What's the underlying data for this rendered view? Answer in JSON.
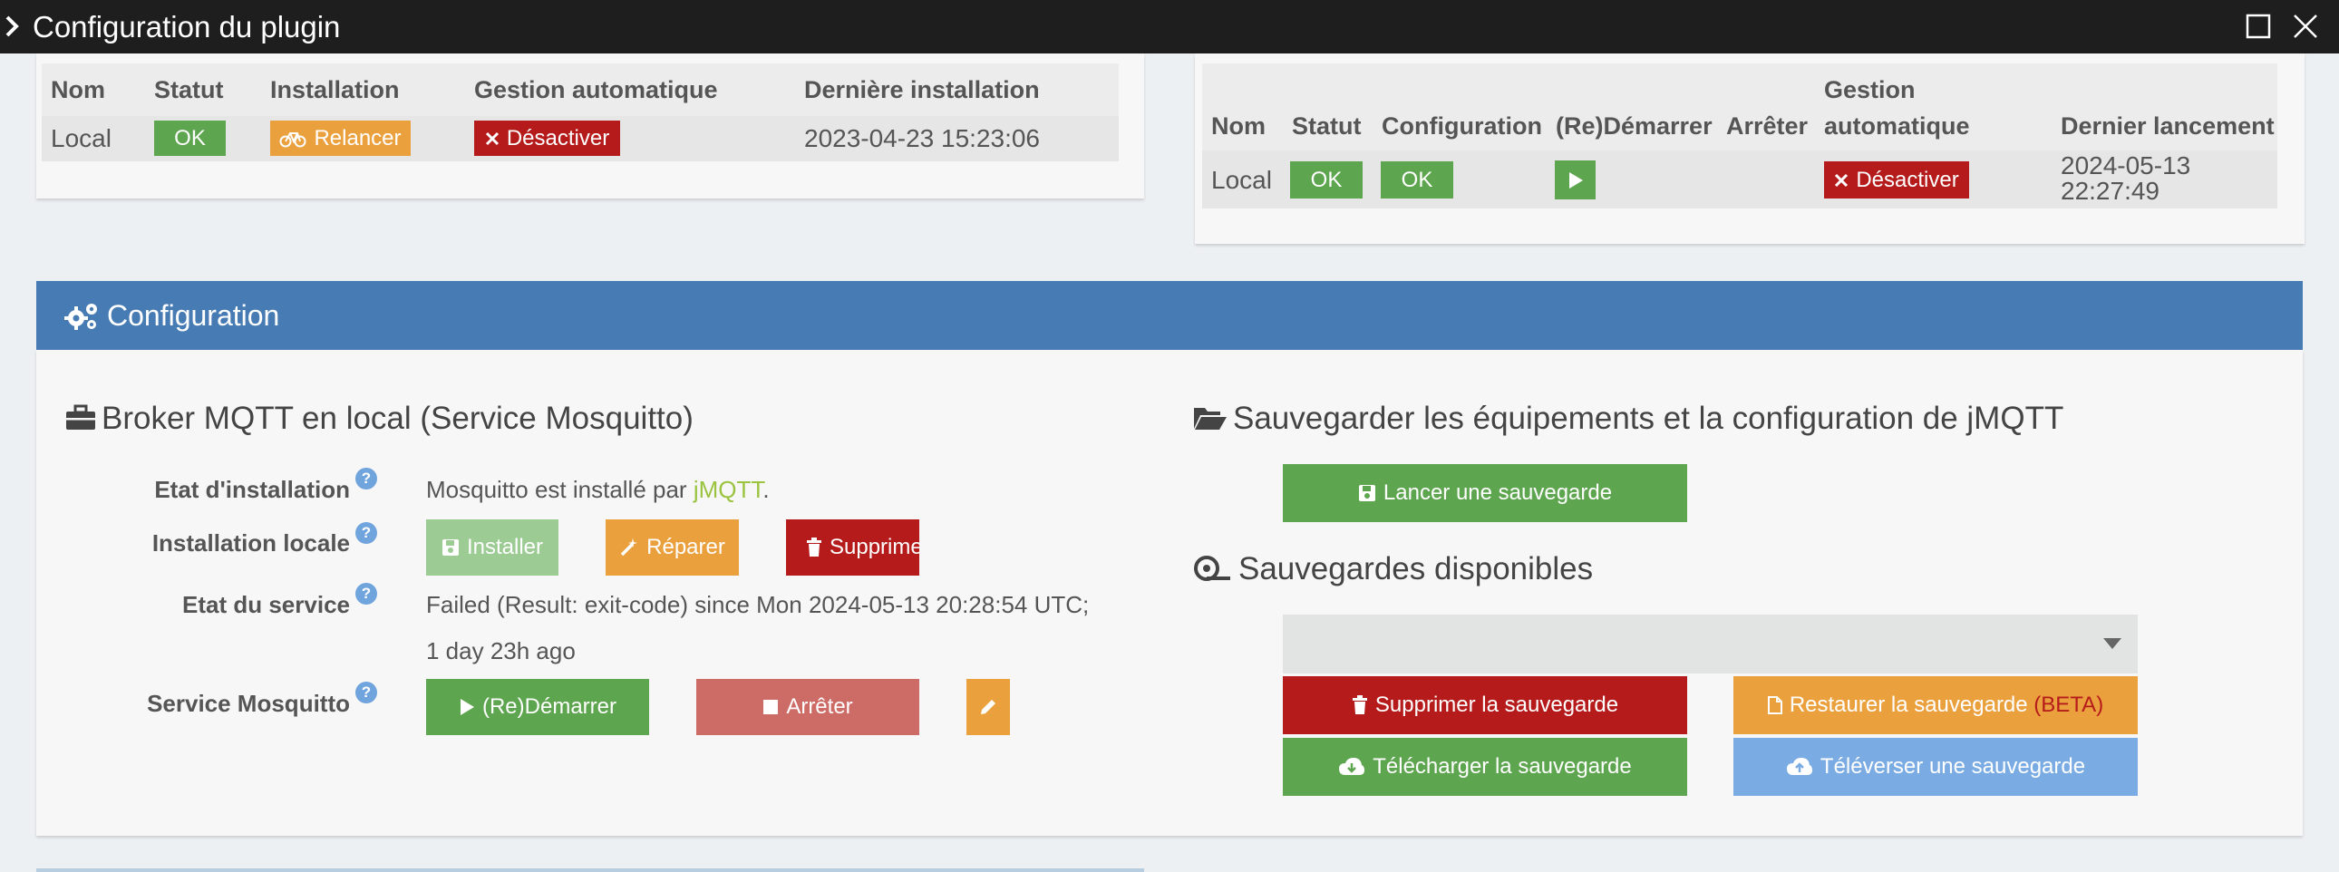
{
  "window": {
    "title": "Configuration du plugin"
  },
  "dependencies": {
    "headers": [
      "Nom",
      "Statut",
      "Installation",
      "Gestion automatique",
      "Dernière installation"
    ],
    "row": {
      "name": "Local",
      "status": "OK",
      "install_button": "Relancer",
      "auto_button": "Désactiver",
      "last_install": "2023-04-23 15:23:06"
    }
  },
  "daemon": {
    "headers": [
      "Nom",
      "Statut",
      "Configuration",
      "(Re)Démarrer",
      "Arrêter",
      "Gestion",
      "automatique",
      "Dernier lancement"
    ],
    "row": {
      "name": "Local",
      "status": "OK",
      "config": "OK",
      "auto_button": "Désactiver",
      "last_launch_date": "2024-05-13",
      "last_launch_time": "22:27:49"
    }
  },
  "config": {
    "header": "Configuration",
    "broker": {
      "title": "Broker MQTT en local (Service Mosquitto)",
      "install_state_label": "Etat d'installation",
      "install_state_prefix": "Mosquitto est installé par ",
      "install_state_link": "jMQTT",
      "install_state_suffix": ".",
      "local_install_label": "Installation locale",
      "btn_install": "Installer",
      "btn_repair": "Réparer",
      "btn_delete": "Supprimer",
      "service_state_label": "Etat du service",
      "service_state_line1": "Failed (Result: exit-code) since Mon 2024-05-13 20:28:54 UTC;",
      "service_state_line2": "1 day 23h ago",
      "service_label": "Service Mosquitto",
      "btn_restart": "(Re)Démarrer",
      "btn_stop": "Arrêter"
    },
    "backup": {
      "title": "Sauvegarder les équipements et la configuration de jMQTT",
      "btn_launch": "Lancer une sauvegarde",
      "available_title": "Sauvegardes disponibles",
      "select_value": "",
      "btn_delete": "Supprimer la sauvegarde",
      "btn_restore": "Restaurer la sauvegarde ",
      "btn_restore_beta": "(BETA)",
      "btn_download": "Télécharger la sauvegarde",
      "btn_upload": "Téléverser une sauvegarde"
    }
  },
  "colors": {
    "title_bar": "#1e1e1e",
    "header_blue": "#477bb4",
    "ok_green": "#5ea54f",
    "warn_orange": "#eba03e",
    "danger_red": "#b51b1b",
    "info_blue": "#7aabe3",
    "link_green": "#9ac33f"
  }
}
